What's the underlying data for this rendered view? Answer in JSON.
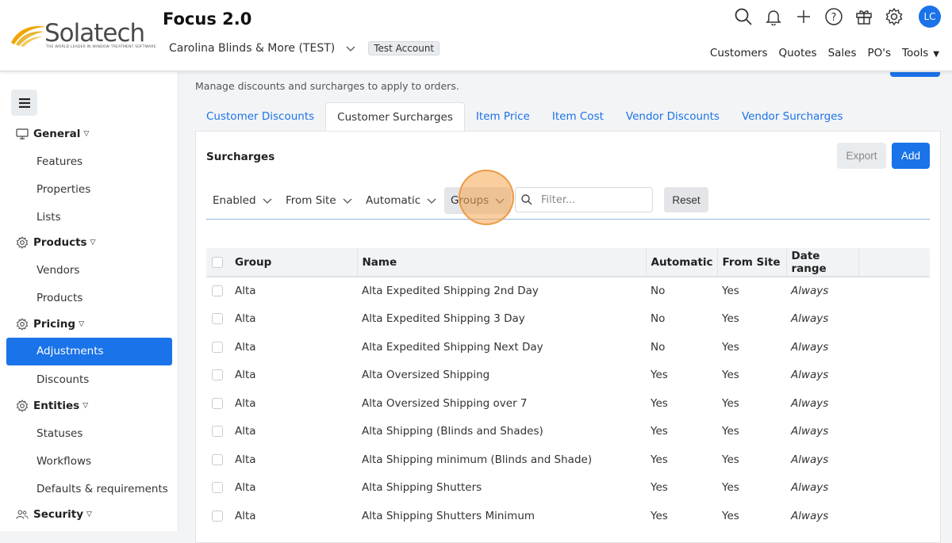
{
  "brand": {
    "name": "Solatech",
    "tagline": "THE WORLD LEADER IN WINDOW TREATMENT SOFTWARE"
  },
  "app_title": "Focus 2.0",
  "account": {
    "name": "Carolina Blinds & More (TEST)",
    "badge": "Test Account"
  },
  "user_initials": "LC",
  "top_nav": [
    "Customers",
    "Quotes",
    "Sales",
    "PO's",
    "Tools"
  ],
  "sidebar": {
    "general": {
      "label": "General",
      "items": [
        "Features",
        "Properties",
        "Lists"
      ]
    },
    "products": {
      "label": "Products",
      "items": [
        "Vendors",
        "Products"
      ]
    },
    "pricing": {
      "label": "Pricing",
      "items": [
        "Adjustments",
        "Discounts"
      ]
    },
    "entities": {
      "label": "Entities",
      "items": [
        "Statuses",
        "Workflows",
        "Defaults & requirements"
      ]
    },
    "security": {
      "label": "Security"
    }
  },
  "page_subtitle": "Manage discounts and surcharges to apply to orders.",
  "tabs": [
    "Customer Discounts",
    "Customer Surcharges",
    "Item Price",
    "Item Cost",
    "Vendor Discounts",
    "Vendor Surcharges"
  ],
  "panel": {
    "title": "Surcharges",
    "export_label": "Export",
    "add_label": "Add",
    "filters": [
      "Enabled",
      "From Site",
      "Automatic",
      "Groups"
    ],
    "search_placeholder": "Filter...",
    "reset_label": "Reset"
  },
  "table": {
    "headers": [
      "Group",
      "Name",
      "Automatic",
      "From Site",
      "Date range"
    ],
    "rows": [
      [
        "Alta",
        "Alta Expedited Shipping 2nd Day",
        "No",
        "Yes",
        "Always"
      ],
      [
        "Alta",
        "Alta Expedited Shipping 3 Day",
        "No",
        "Yes",
        "Always"
      ],
      [
        "Alta",
        "Alta Expedited Shipping Next Day",
        "No",
        "Yes",
        "Always"
      ],
      [
        "Alta",
        "Alta Oversized Shipping",
        "Yes",
        "Yes",
        "Always"
      ],
      [
        "Alta",
        "Alta Oversized Shipping over 7",
        "Yes",
        "Yes",
        "Always"
      ],
      [
        "Alta",
        "Alta Shipping (Blinds and Shades)",
        "Yes",
        "Yes",
        "Always"
      ],
      [
        "Alta",
        "Alta Shipping minimum (Blinds and Shade)",
        "Yes",
        "Yes",
        "Always"
      ],
      [
        "Alta",
        "Alta Shipping Shutters",
        "Yes",
        "Yes",
        "Always"
      ],
      [
        "Alta",
        "Alta Shipping Shutters Minimum",
        "Yes",
        "Yes",
        "Always"
      ]
    ]
  },
  "colors": {
    "accent": "#1a73e8",
    "highlight": "#f5a650"
  }
}
